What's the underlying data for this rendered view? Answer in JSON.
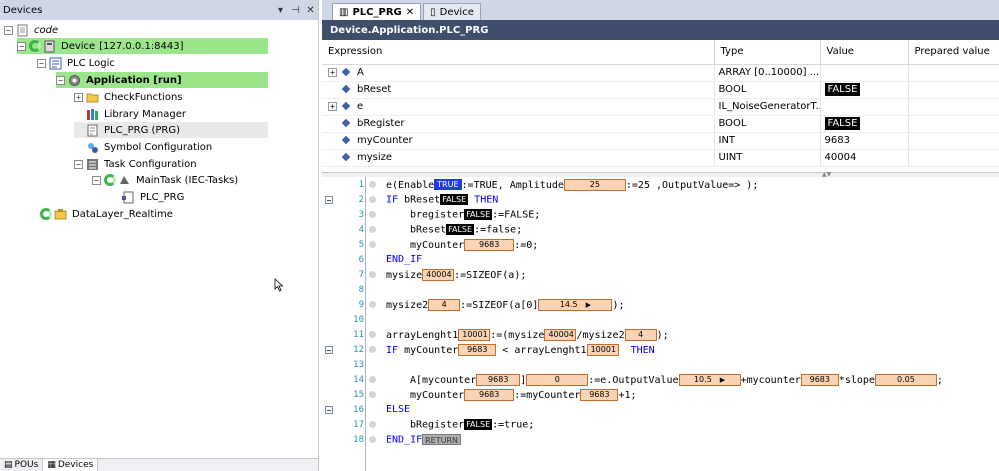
{
  "devices_panel": {
    "title": "Devices",
    "buttons": [
      "▾",
      "⊣",
      "✕"
    ],
    "tree": [
      {
        "label": "code"
      },
      {
        "label": "Device",
        "extra": "[127.0.0.1:8443]"
      },
      {
        "label": "PLC Logic"
      },
      {
        "label": "Application [run]"
      },
      {
        "label": "CheckFunctions"
      },
      {
        "label": "Library Manager"
      },
      {
        "label": "PLC_PRG (PRG)"
      },
      {
        "label": "Symbol Configuration"
      },
      {
        "label": "Task Configuration"
      },
      {
        "label": "MainTask (IEC-Tasks)"
      },
      {
        "label": "PLC_PRG"
      },
      {
        "label": "DataLayer_Realtime"
      }
    ],
    "bottom_tabs": [
      "POUs",
      "Devices"
    ]
  },
  "editor": {
    "tabs": [
      {
        "label": "PLC_PRG",
        "close": "✕"
      },
      {
        "label": "Device"
      }
    ],
    "path": "Device.Application.PLC_PRG",
    "watch": {
      "columns": [
        "Expression",
        "Type",
        "Value",
        "Prepared value"
      ],
      "rows": [
        {
          "expr": "A",
          "type": "ARRAY [0..10000] ...",
          "value": ""
        },
        {
          "expr": "bReset",
          "type": "BOOL",
          "value": "FALSE"
        },
        {
          "expr": "e",
          "type": "IL_NoiseGeneratorT...",
          "value": ""
        },
        {
          "expr": "bRegister",
          "type": "BOOL",
          "value": "FALSE"
        },
        {
          "expr": "myCounter",
          "type": "INT",
          "value": "9683"
        },
        {
          "expr": "mysize",
          "type": "UINT",
          "value": "40004"
        }
      ]
    },
    "code": {
      "line_numbers": [
        "1",
        "2",
        "3",
        "4",
        "5",
        "6",
        "7",
        "8",
        "9",
        "10",
        "11",
        "12",
        "13",
        "14",
        "15",
        "16",
        "17",
        "18"
      ],
      "l1": {
        "a": "e(Enable",
        "m1": "TRUE",
        "b": ":=TRUE, Amplitude",
        "m2": "25",
        "c": ":=25 ,OutputValue=> );"
      },
      "l2": {
        "kw1": "IF",
        "a": " bReset",
        "m1": "FALSE",
        "kw2": "THEN"
      },
      "l3": {
        "a": "bregister",
        "m1": "FALSE",
        "b": ":=FALSE;"
      },
      "l4": {
        "a": "bReset",
        "m1": "FALSE",
        "b": ":=false;"
      },
      "l5": {
        "a": "myCounter",
        "m1": "9683",
        "b": ":=0;"
      },
      "l6": {
        "kw1": "END_IF"
      },
      "l7": {
        "a": "mysize",
        "m1": "40004",
        "b": ":=SIZEOF(a);"
      },
      "l9": {
        "a": "mysize2",
        "m1": "4",
        "b": ":=SIZEOF(a[0]",
        "m2": "14.5",
        "c": ");"
      },
      "l11": {
        "a": "arrayLenght1",
        "m1": "10001",
        "b": ":=(mysize",
        "m2": "40004",
        "c": "/mysize2",
        "m3": "4",
        "d": ");"
      },
      "l12": {
        "kw1": "IF",
        "a": " myCounter",
        "m1": "9683",
        "b": " < arrayLenght1",
        "m2": "10001",
        "kw2": "THEN"
      },
      "l14": {
        "a": "A[mycounter",
        "m1": "9683",
        "b": "]",
        "m2": "0",
        "c": ":=e.OutputValue",
        "m3": "10.5",
        "d": "+mycounter",
        "m4": "9683",
        "e": "*slope",
        "m5": "0.05",
        "f": ";"
      },
      "l15": {
        "a": "myCounter",
        "m1": "9683",
        "b": ":=myCounter",
        "m2": "9683",
        "c": "+1;"
      },
      "l16": {
        "kw1": "ELSE"
      },
      "l17": {
        "a": "bRegister",
        "m1": "FALSE",
        "b": ":=true;"
      },
      "l18": {
        "kw1": "END_IF",
        "m1": "RETURN"
      }
    }
  }
}
